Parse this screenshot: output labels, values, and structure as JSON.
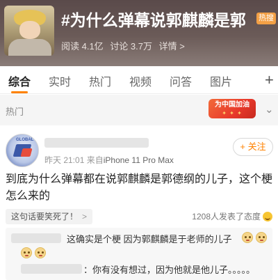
{
  "topic": {
    "title": "#为什么弹幕说郭麒麟是郭",
    "badge": "热搜",
    "reads": "阅读 4.1亿",
    "discussions": "讨论 3.7万",
    "details": "详情 >"
  },
  "tabs": [
    {
      "label": "综合",
      "active": true
    },
    {
      "label": "实时",
      "active": false
    },
    {
      "label": "热门",
      "active": false
    },
    {
      "label": "视频",
      "active": false
    },
    {
      "label": "问答",
      "active": false
    },
    {
      "label": "图片",
      "active": false
    }
  ],
  "section": {
    "label": "热门",
    "promo": "为中国加油"
  },
  "post": {
    "time": "昨天 21:01",
    "source_prefix": "来自",
    "device": "iPhone 11 Pro Max",
    "follow_label": "+ 关注",
    "text": "到底为什么弹幕都在说郭麒麟是郭德纲的儿子，这个梗怎么来的",
    "hot_comment_label": "这句话要笑死了！",
    "attitude": "1208人发表了态度"
  },
  "comments": [
    {
      "text": "这确实是个梗 因为郭麒麟是于老师的儿子"
    },
    {
      "text": "：你有没有想过，因为他就是他儿子。。。。。"
    }
  ],
  "colors": {
    "accent": "#ff8200",
    "badge": "#f3a045"
  }
}
